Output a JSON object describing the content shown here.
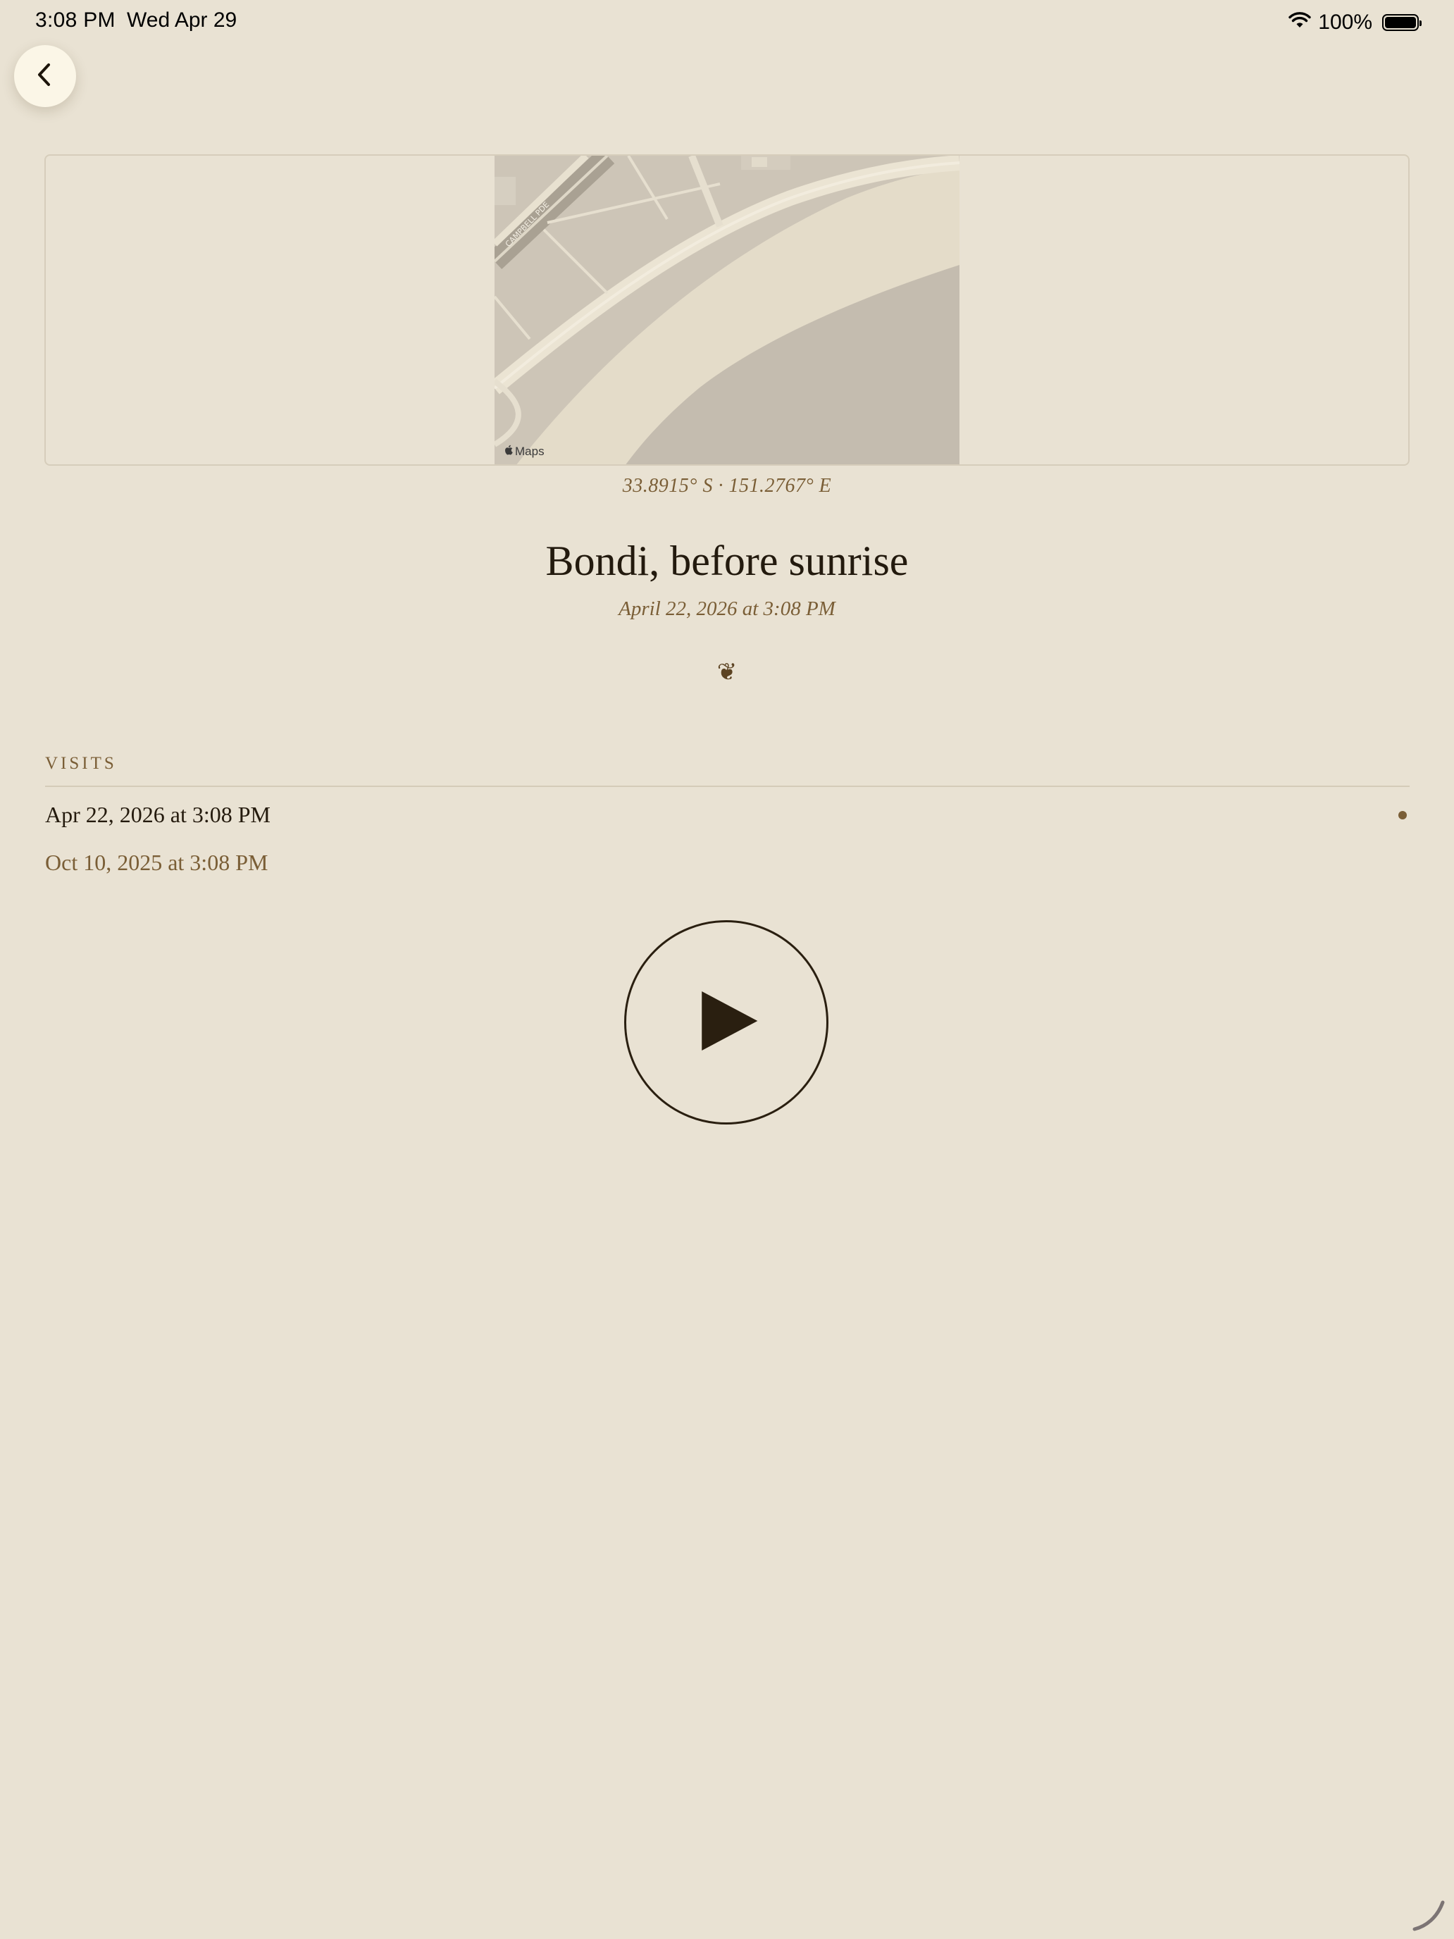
{
  "status_bar": {
    "time": "3:08 PM",
    "date": "Wed Apr 29",
    "battery": "100%"
  },
  "map": {
    "attribution": "Maps",
    "street_label": "CAMPBELL PDE"
  },
  "location": {
    "coordinates": "33.8915° S  ·  151.2767° E"
  },
  "entry": {
    "title": "Bondi, before sunrise",
    "timestamp": "April 22, 2026 at 3:08 PM",
    "ornament": "❦"
  },
  "visits": {
    "header": "VISITS",
    "items": [
      {
        "label": "Apr 22, 2026 at 3:08 PM",
        "current": true
      },
      {
        "label": "Oct 10, 2025 at 3:08 PM",
        "current": false
      }
    ]
  },
  "colors": {
    "background": "#e9e2d3",
    "accent": "#7a5e36",
    "ink": "#2a1f10"
  },
  "icons": {
    "back": "chevron-left-icon",
    "play": "play-icon",
    "wifi": "wifi-icon",
    "battery": "battery-icon"
  }
}
